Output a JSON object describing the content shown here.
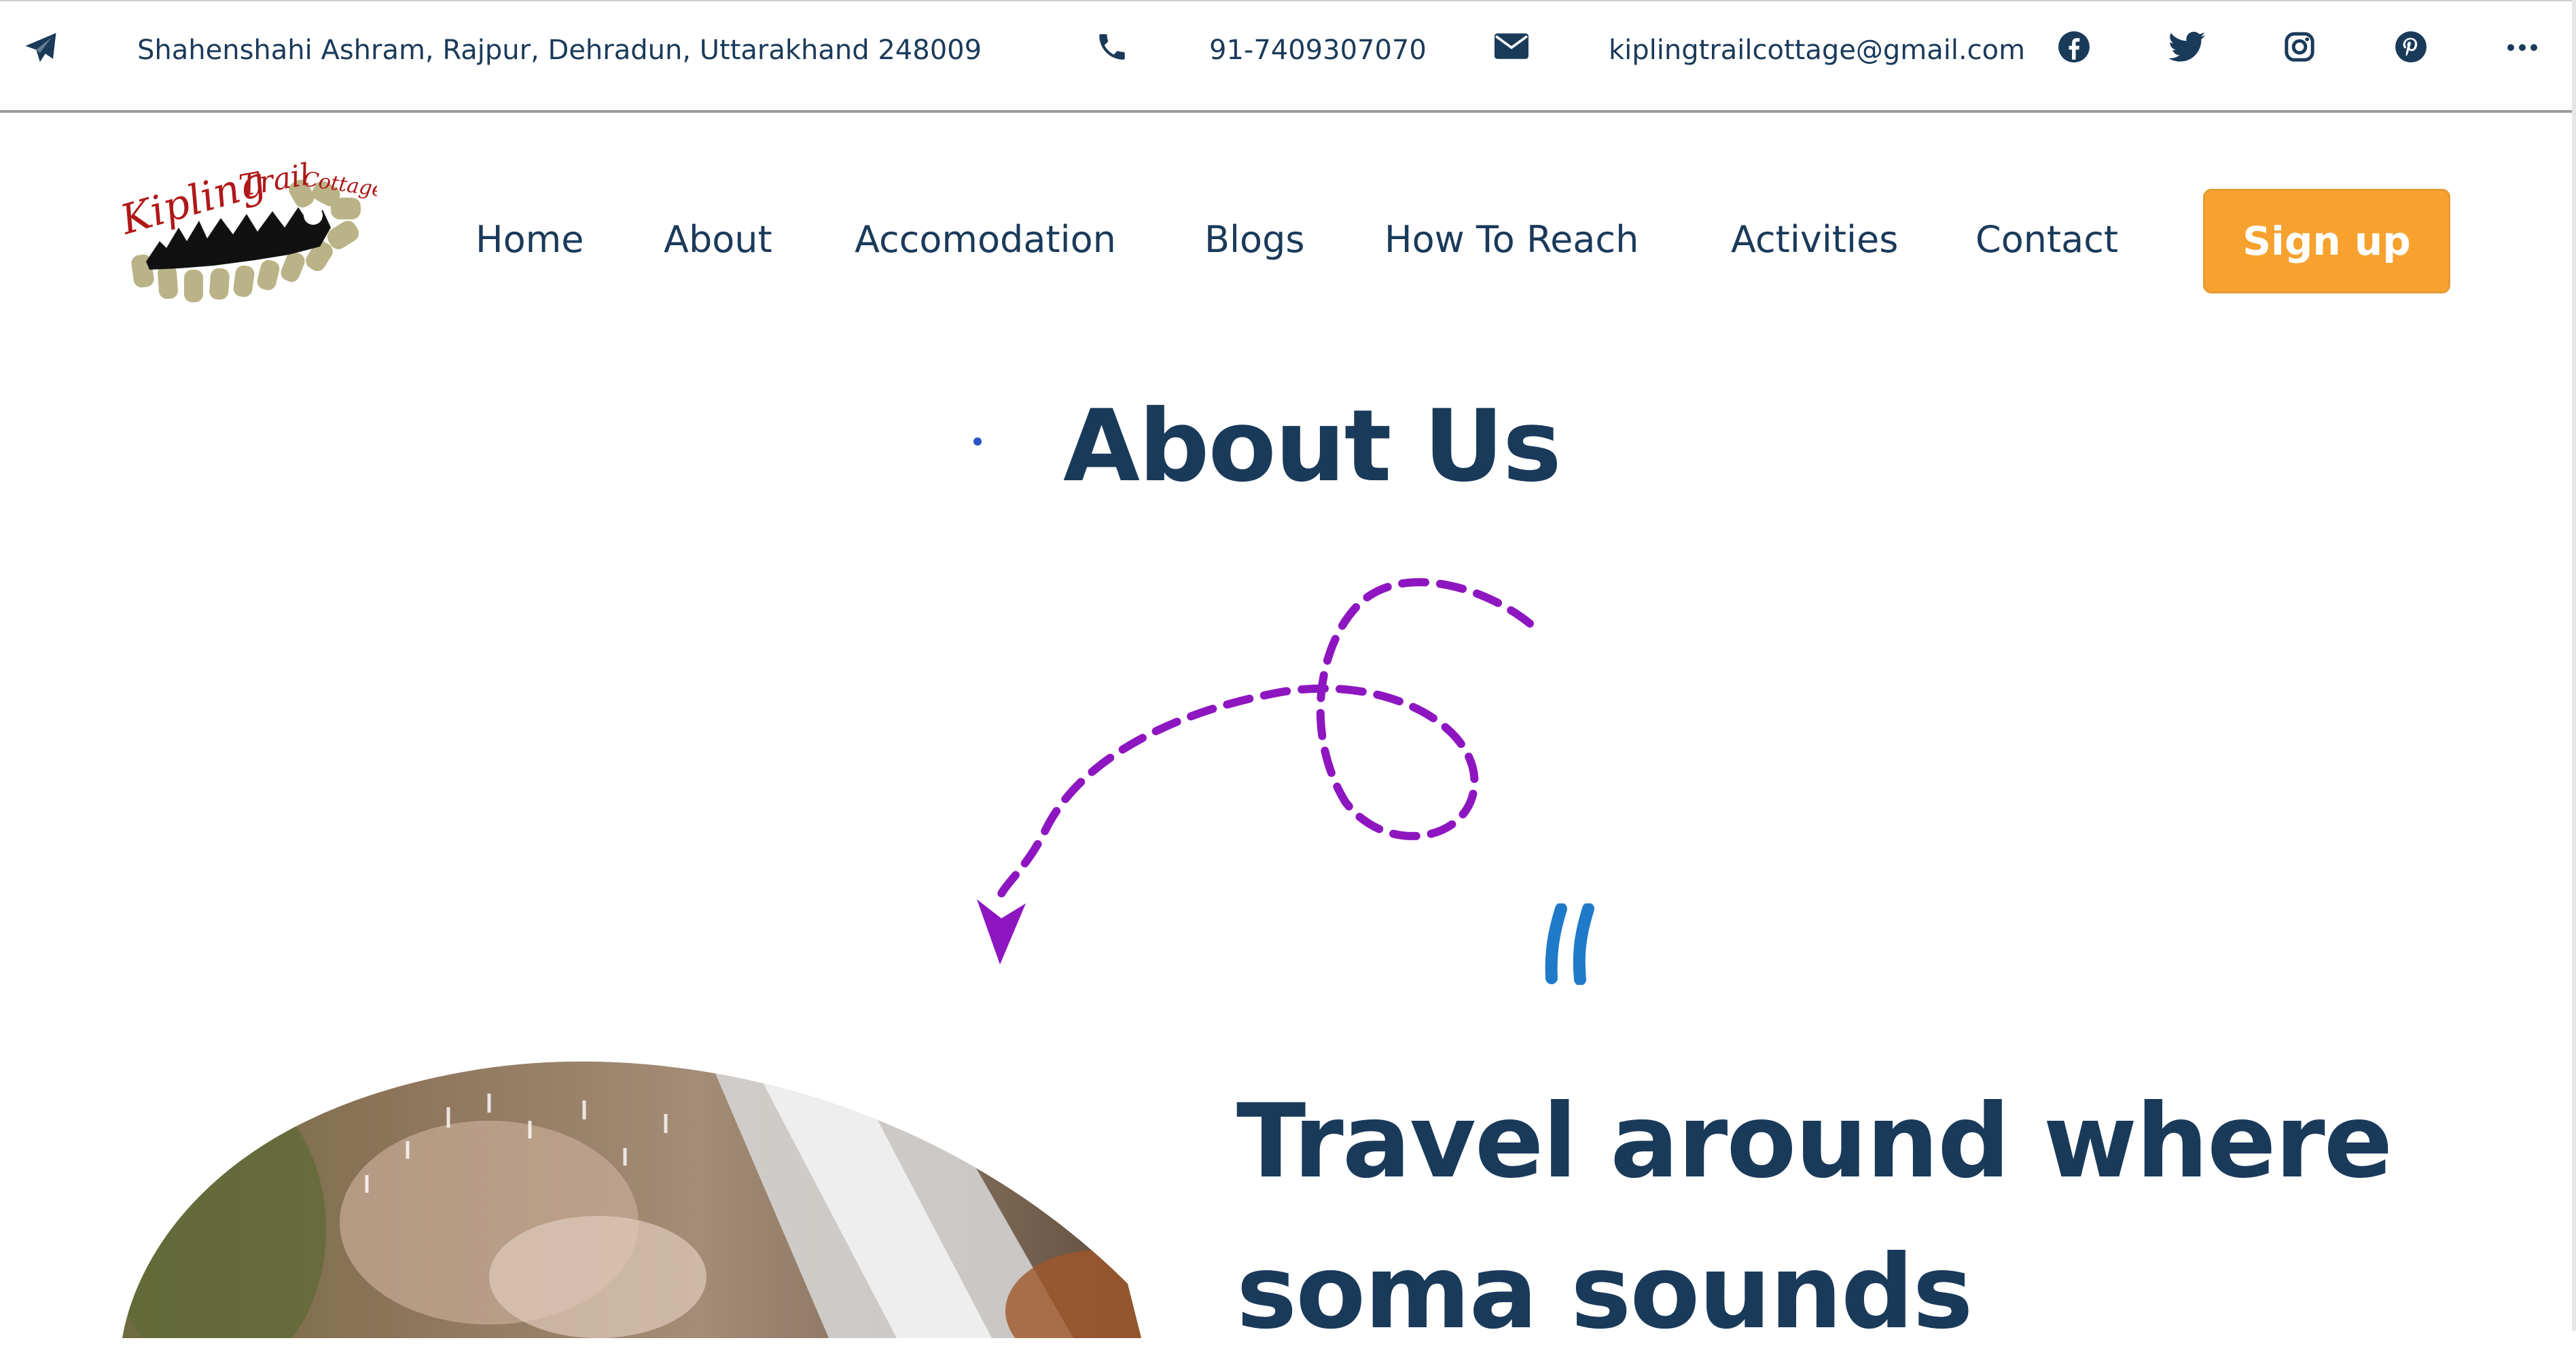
{
  "topbar": {
    "address": "Shahenshahi Ashram, Rajpur, Dehradun, Uttarakhand 248009",
    "phone": "91-7409307070",
    "email": "kiplingtrailcottage@gmail.com",
    "icons": [
      "paper-plane-icon",
      "phone-icon",
      "envelope-icon",
      "facebook-icon",
      "twitter-icon",
      "instagram-icon",
      "pinterest-icon",
      "more-dots-icon"
    ]
  },
  "logo": {
    "text": "Kipling Trail Cottage"
  },
  "nav": {
    "items": [
      "Home",
      "About",
      "Accomodation",
      "Blogs",
      "How To Reach",
      "Activities",
      "Contact"
    ],
    "signup_label": "Sign up"
  },
  "main": {
    "title": "About Us",
    "headline_line1": "Travel around where",
    "headline_line2": "soma sounds"
  },
  "colors": {
    "primary": "#1a3a5a",
    "accent": "#f7a12e",
    "arrow": "#8e16c0",
    "quote": "#1f7ac9"
  }
}
